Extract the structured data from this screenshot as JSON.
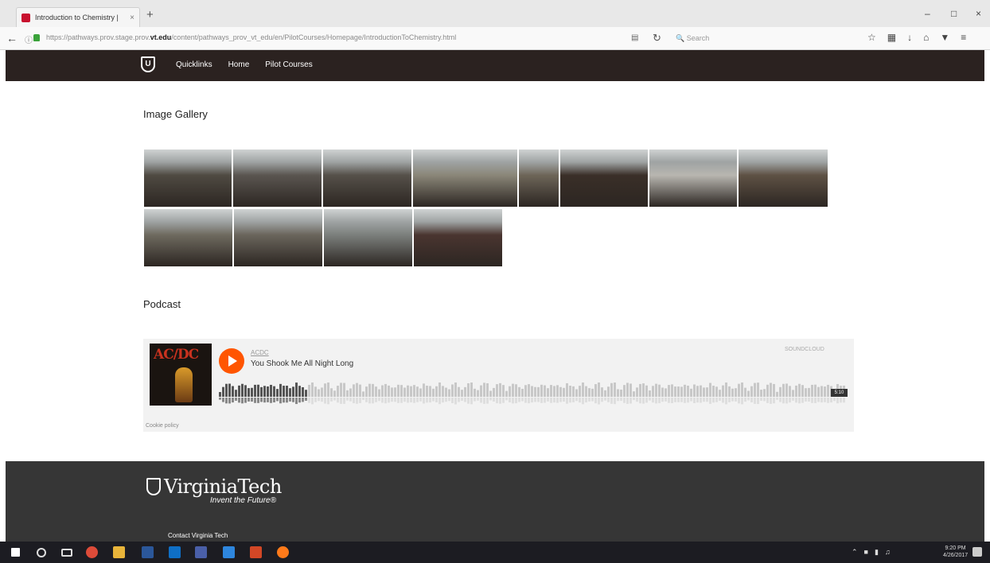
{
  "browser": {
    "tab_title": "Introduction to Chemistry |",
    "tab_close": "×",
    "new_tab": "+",
    "window_controls": [
      "–",
      "□",
      "×"
    ],
    "url_prefix": "https://pathways.prov.stage.prov.",
    "url_domain": "vt.edu",
    "url_path": "/content/pathways_prov_vt_edu/en/PilotCourses/Homepage/IntroductionToChemistry.html",
    "search_placeholder": "Search"
  },
  "site_nav": {
    "items": [
      "Quicklinks",
      "Home",
      "Pilot Courses"
    ]
  },
  "gallery": {
    "heading": "Image Gallery",
    "photos": [
      {
        "name": "gallery-photo-1",
        "color": "#4f4a42"
      },
      {
        "name": "gallery-photo-2",
        "color": "#5a5550"
      },
      {
        "name": "gallery-photo-3",
        "color": "#555049"
      },
      {
        "name": "gallery-photo-4",
        "color": "#8a8678"
      },
      {
        "name": "gallery-photo-5",
        "color": "#6d6558"
      },
      {
        "name": "gallery-photo-6",
        "color": "#3a2f28"
      },
      {
        "name": "gallery-photo-7",
        "color": "#b8b6b0"
      },
      {
        "name": "gallery-photo-8",
        "color": "#5e5144"
      },
      {
        "name": "gallery-photo-9",
        "color": "#6e6a5f"
      },
      {
        "name": "gallery-photo-10",
        "color": "#6a655c"
      },
      {
        "name": "gallery-photo-11",
        "color": "#7b7f7c"
      },
      {
        "name": "gallery-photo-12",
        "color": "#4a3530"
      }
    ]
  },
  "podcast": {
    "heading": "Podcast",
    "artist": "ACDC",
    "track": "You Shook Me All Night Long",
    "art_text": "AC/DC",
    "brand": "SOUNDCLOUD",
    "duration": "5:10",
    "cookie": "Cookie policy",
    "accent_color": "#ff5500"
  },
  "footer": {
    "logo_name": "VirginiaTech",
    "logo_tagline": "Invent the Future",
    "contact": "Contact Virginia Tech"
  },
  "taskbar": {
    "clock_time": "9:20 PM",
    "clock_date": "4/26/2017"
  }
}
